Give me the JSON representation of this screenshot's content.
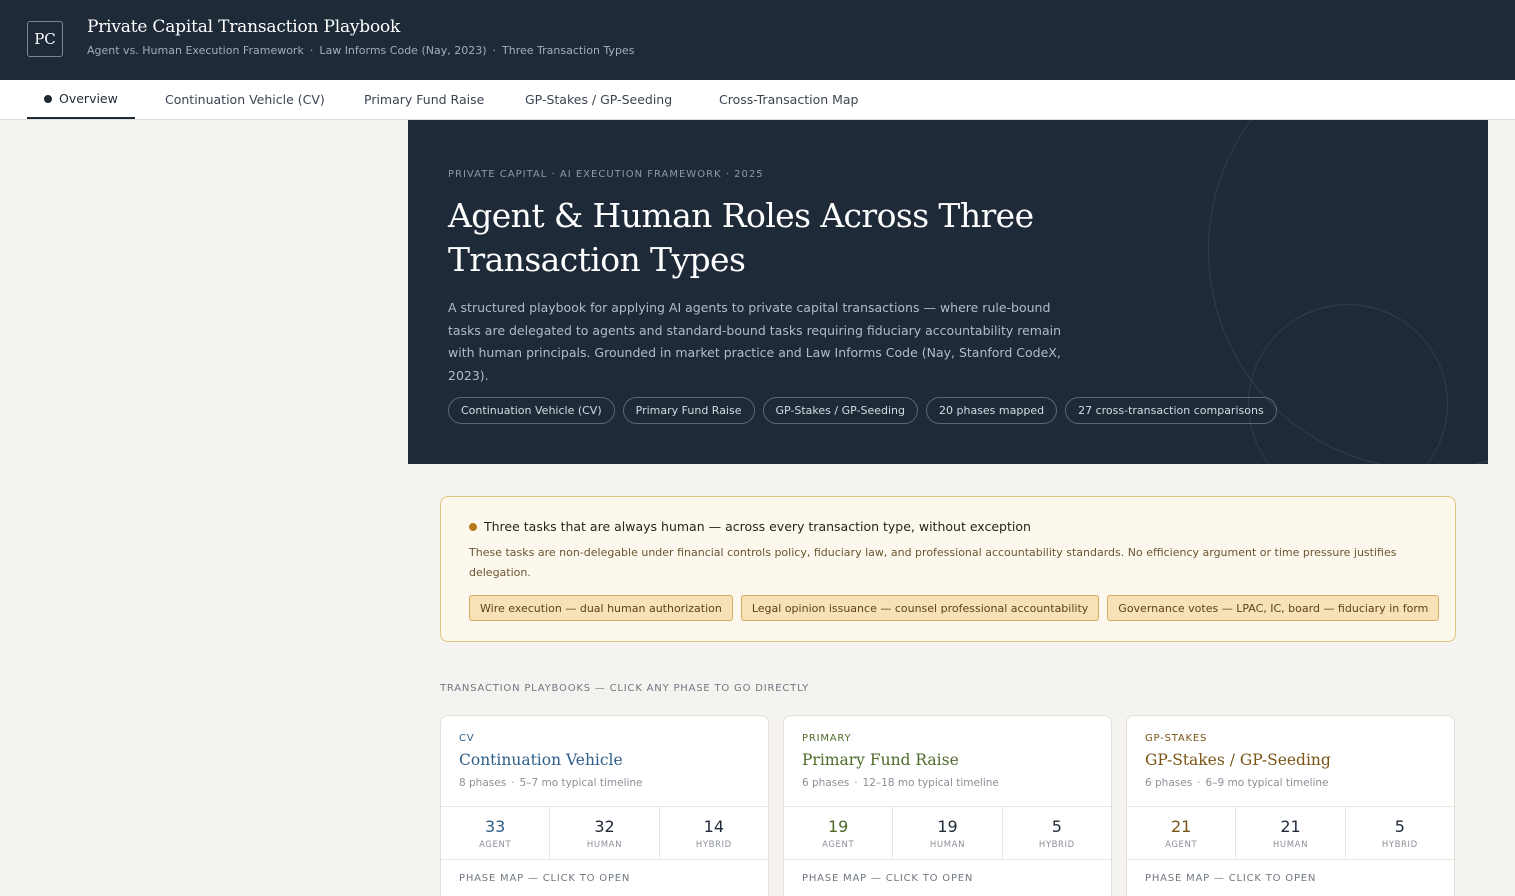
{
  "app": {
    "logo_text": "PC",
    "title": "Private Capital Transaction Playbook",
    "subtitle_parts": [
      "Agent vs. Human Execution Framework",
      "Law Informs Code (Nay, 2023)",
      "Three Transaction Types"
    ],
    "subtitle_separator": "·"
  },
  "tabs": [
    {
      "label": "Overview",
      "active": true
    },
    {
      "label": "Continuation Vehicle (CV)",
      "active": false
    },
    {
      "label": "Primary Fund Raise",
      "active": false
    },
    {
      "label": "GP-Stakes / GP-Seeding",
      "active": false
    },
    {
      "label": "Cross-Transaction Map",
      "active": false
    }
  ],
  "hero": {
    "eyebrow": "PRIVATE CAPITAL · AI EXECUTION FRAMEWORK · 2025",
    "title": "Agent & Human Roles Across Three Transaction Types",
    "description": "A structured playbook for applying AI agents to private capital transactions — where rule-bound tasks are delegated to agents and standard-bound tasks requiring fiduciary accountability remain with human principals. Grounded in market practice and Law Informs Code (Nay, Stanford CodeX, 2023).",
    "chips": [
      "Continuation Vehicle (CV)",
      "Primary Fund Raise",
      "GP-Stakes / GP-Seeding",
      "20 phases mapped",
      "27 cross-transaction comparisons"
    ]
  },
  "notice": {
    "heading": "Three tasks that are always human — across every transaction type, without exception",
    "body": "These tasks are non-delegable under financial controls policy, fiduciary law, and professional accountability standards. No efficiency argument or time pressure justifies delegation.",
    "pills": [
      "Wire execution — dual human authorization",
      "Legal opinion issuance — counsel professional accountability",
      "Governance votes — LPAC, IC, board — fiduciary in form"
    ],
    "accent_color": "#b8791a"
  },
  "section_label": "TRANSACTION PLAYBOOKS — CLICK ANY PHASE TO GO DIRECTLY",
  "cards": [
    {
      "tag": "CV",
      "title": "Continuation Vehicle",
      "phases": "8 phases",
      "timeline": "5–7 mo typical timeline",
      "agent": "33",
      "human": "32",
      "hybrid": "14",
      "accent_color": "#2e5f8a",
      "phase_label": "PHASE MAP — CLICK TO OPEN"
    },
    {
      "tag": "PRIMARY",
      "title": "Primary Fund Raise",
      "phases": "6 phases",
      "timeline": "12–18 mo typical timeline",
      "agent": "19",
      "human": "19",
      "hybrid": "5",
      "accent_color": "#4f6a2a",
      "phase_label": "PHASE MAP — CLICK TO OPEN"
    },
    {
      "tag": "GP-STAKES",
      "title": "GP-Stakes / GP-Seeding",
      "phases": "6 phases",
      "timeline": "6–9 mo typical timeline",
      "agent": "21",
      "human": "21",
      "hybrid": "5",
      "accent_color": "#7a5414",
      "phase_label": "PHASE MAP — CLICK TO OPEN"
    }
  ],
  "stat_labels": {
    "agent": "AGENT",
    "human": "HUMAN",
    "hybrid": "HYBRID"
  }
}
